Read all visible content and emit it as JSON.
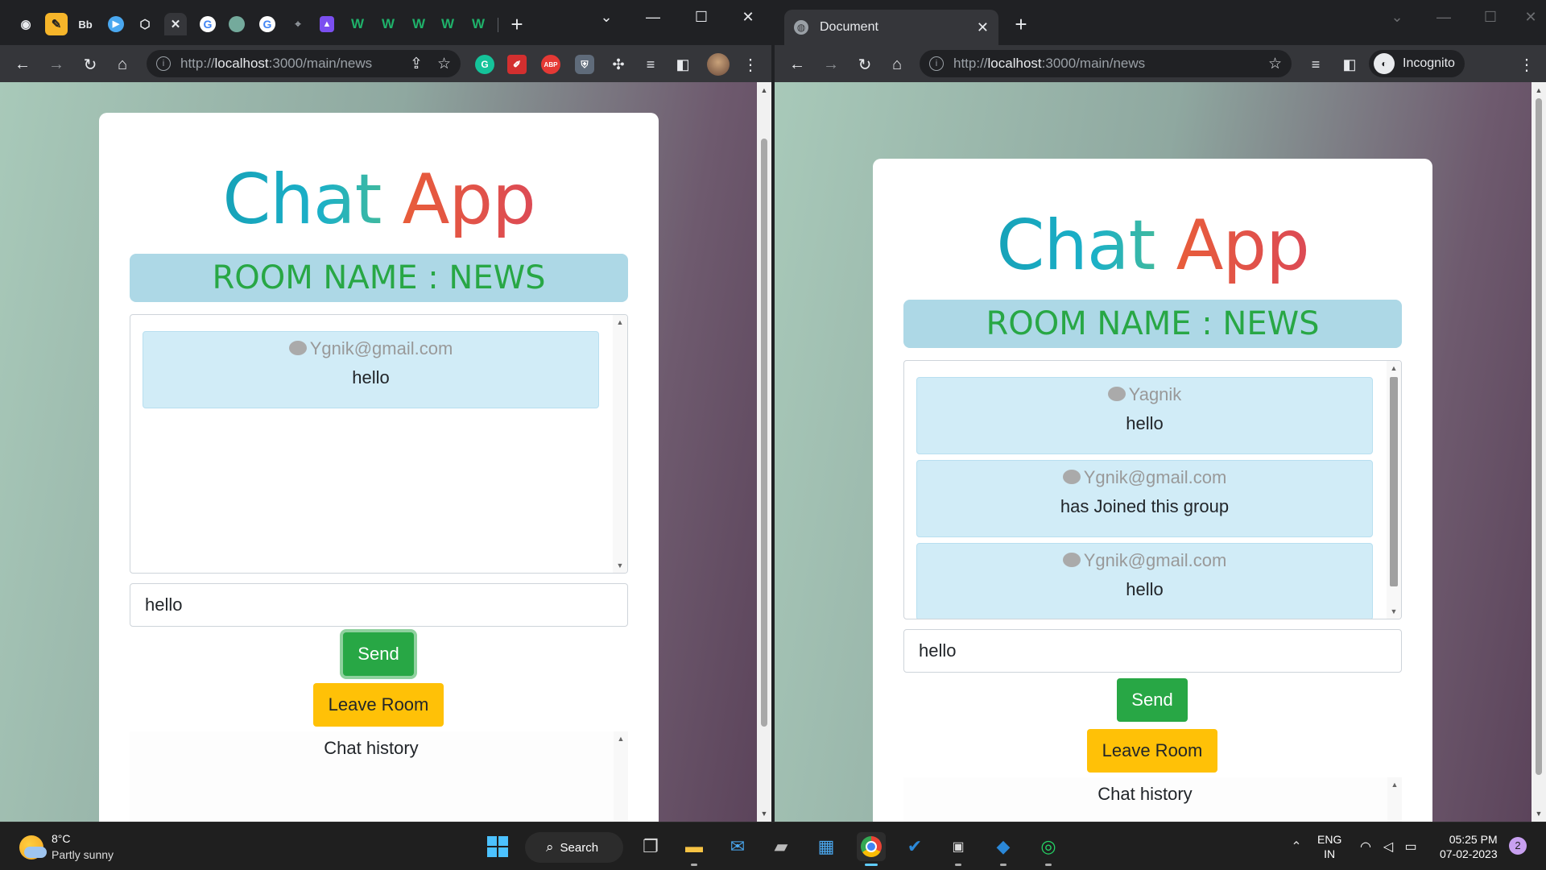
{
  "left_window": {
    "url": {
      "scheme": "http://",
      "host": "localhost",
      "rest": ":3000/main/news"
    },
    "pinned_tabs": [
      "github",
      "notes",
      "Bb",
      "play",
      "codepen",
      "close",
      "google",
      "chatgpt",
      "google",
      "cursor",
      "figma",
      "w",
      "w",
      "w",
      "w",
      "w"
    ],
    "pinned_labels": {
      "bb": "Bb",
      "w": "W"
    }
  },
  "right_window": {
    "tab_title": "Document",
    "url": {
      "scheme": "http://",
      "host": "localhost",
      "rest": ":3000/main/news"
    },
    "incognito_label": "Incognito"
  },
  "chat_app": {
    "title_part1": "Chat",
    "title_part2": "App",
    "room_banner": "ROOM NAME : NEWS",
    "send_label": "Send",
    "leave_label": "Leave Room",
    "history_label": "Chat history",
    "colors": {
      "banner_bg": "#add8e6",
      "banner_text": "#28a745",
      "send": "#28a745",
      "leave": "#ffc107",
      "message_bg": "#d1ecf7"
    }
  },
  "left_chat": {
    "input_value": "hello",
    "messages": [
      {
        "user": "Ygnik@gmail.com",
        "text": "hello"
      }
    ]
  },
  "right_chat": {
    "input_value": "hello",
    "messages": [
      {
        "user": "Yagnik",
        "text": "hello"
      },
      {
        "user": "Ygnik@gmail.com",
        "text": "has Joined this group"
      },
      {
        "user": "Ygnik@gmail.com",
        "text": "hello"
      }
    ]
  },
  "taskbar": {
    "weather_temp": "8°C",
    "weather_desc": "Partly sunny",
    "search_label": "Search",
    "lang_top": "ENG",
    "lang_bottom": "IN",
    "time": "05:25 PM",
    "date": "07-02-2023",
    "notification_count": "2"
  }
}
